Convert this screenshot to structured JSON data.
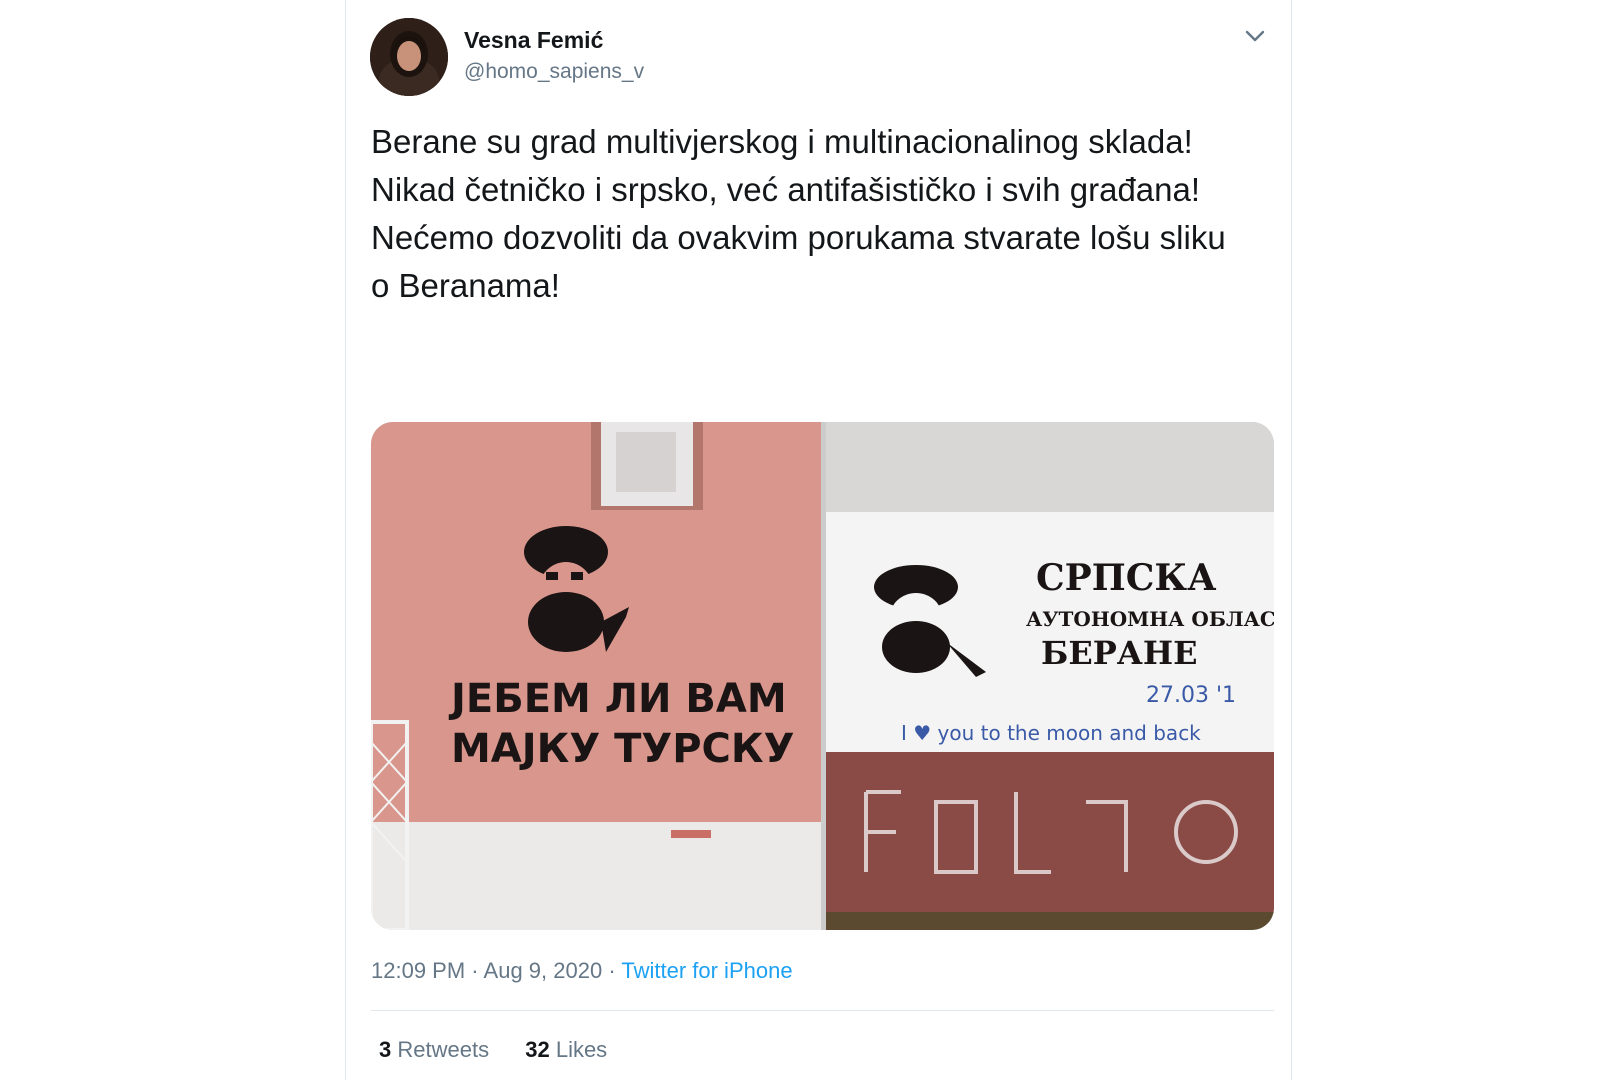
{
  "tweet": {
    "author_name": "Vesna Femić",
    "author_handle": "@homo_sapiens_v",
    "lines": [
      "Berane su grad multivjerskog i multinacionalinog sklada!",
      "Nikad četničko i srpsko, već antifašističko i svih građana!",
      "Nećemo dozvoliti da ovakvim porukama stvarate lošu sliku o Beranama!"
    ],
    "time": "12:09 PM",
    "separator": "·",
    "date": "Aug 9, 2020",
    "source": "Twitter for iPhone",
    "retweets_count": "3",
    "retweets_label": "Retweets",
    "likes_count": "32",
    "likes_label": "Likes"
  },
  "photos": {
    "left": {
      "line1": "ЈЕБЕМ ЛИ ВАМ",
      "line2": "МАЈКУ ТУРСКУ"
    },
    "right": {
      "line1": "СРПСКА",
      "line2": "АУТОНОМНА ОБЛАСТ",
      "line3": "БЕРАНЕ",
      "date": "27.03 '1",
      "handwriting": "I ♥ you to the moon and back"
    }
  },
  "icons": {
    "avatar": "avatar-photo",
    "menu": "chevron-down-icon"
  },
  "colors": {
    "link": "#1da1f2",
    "muted": "#657786",
    "text": "#14171a",
    "wall_pink": "#d8968c",
    "wall_brick": "#8a4a45"
  }
}
